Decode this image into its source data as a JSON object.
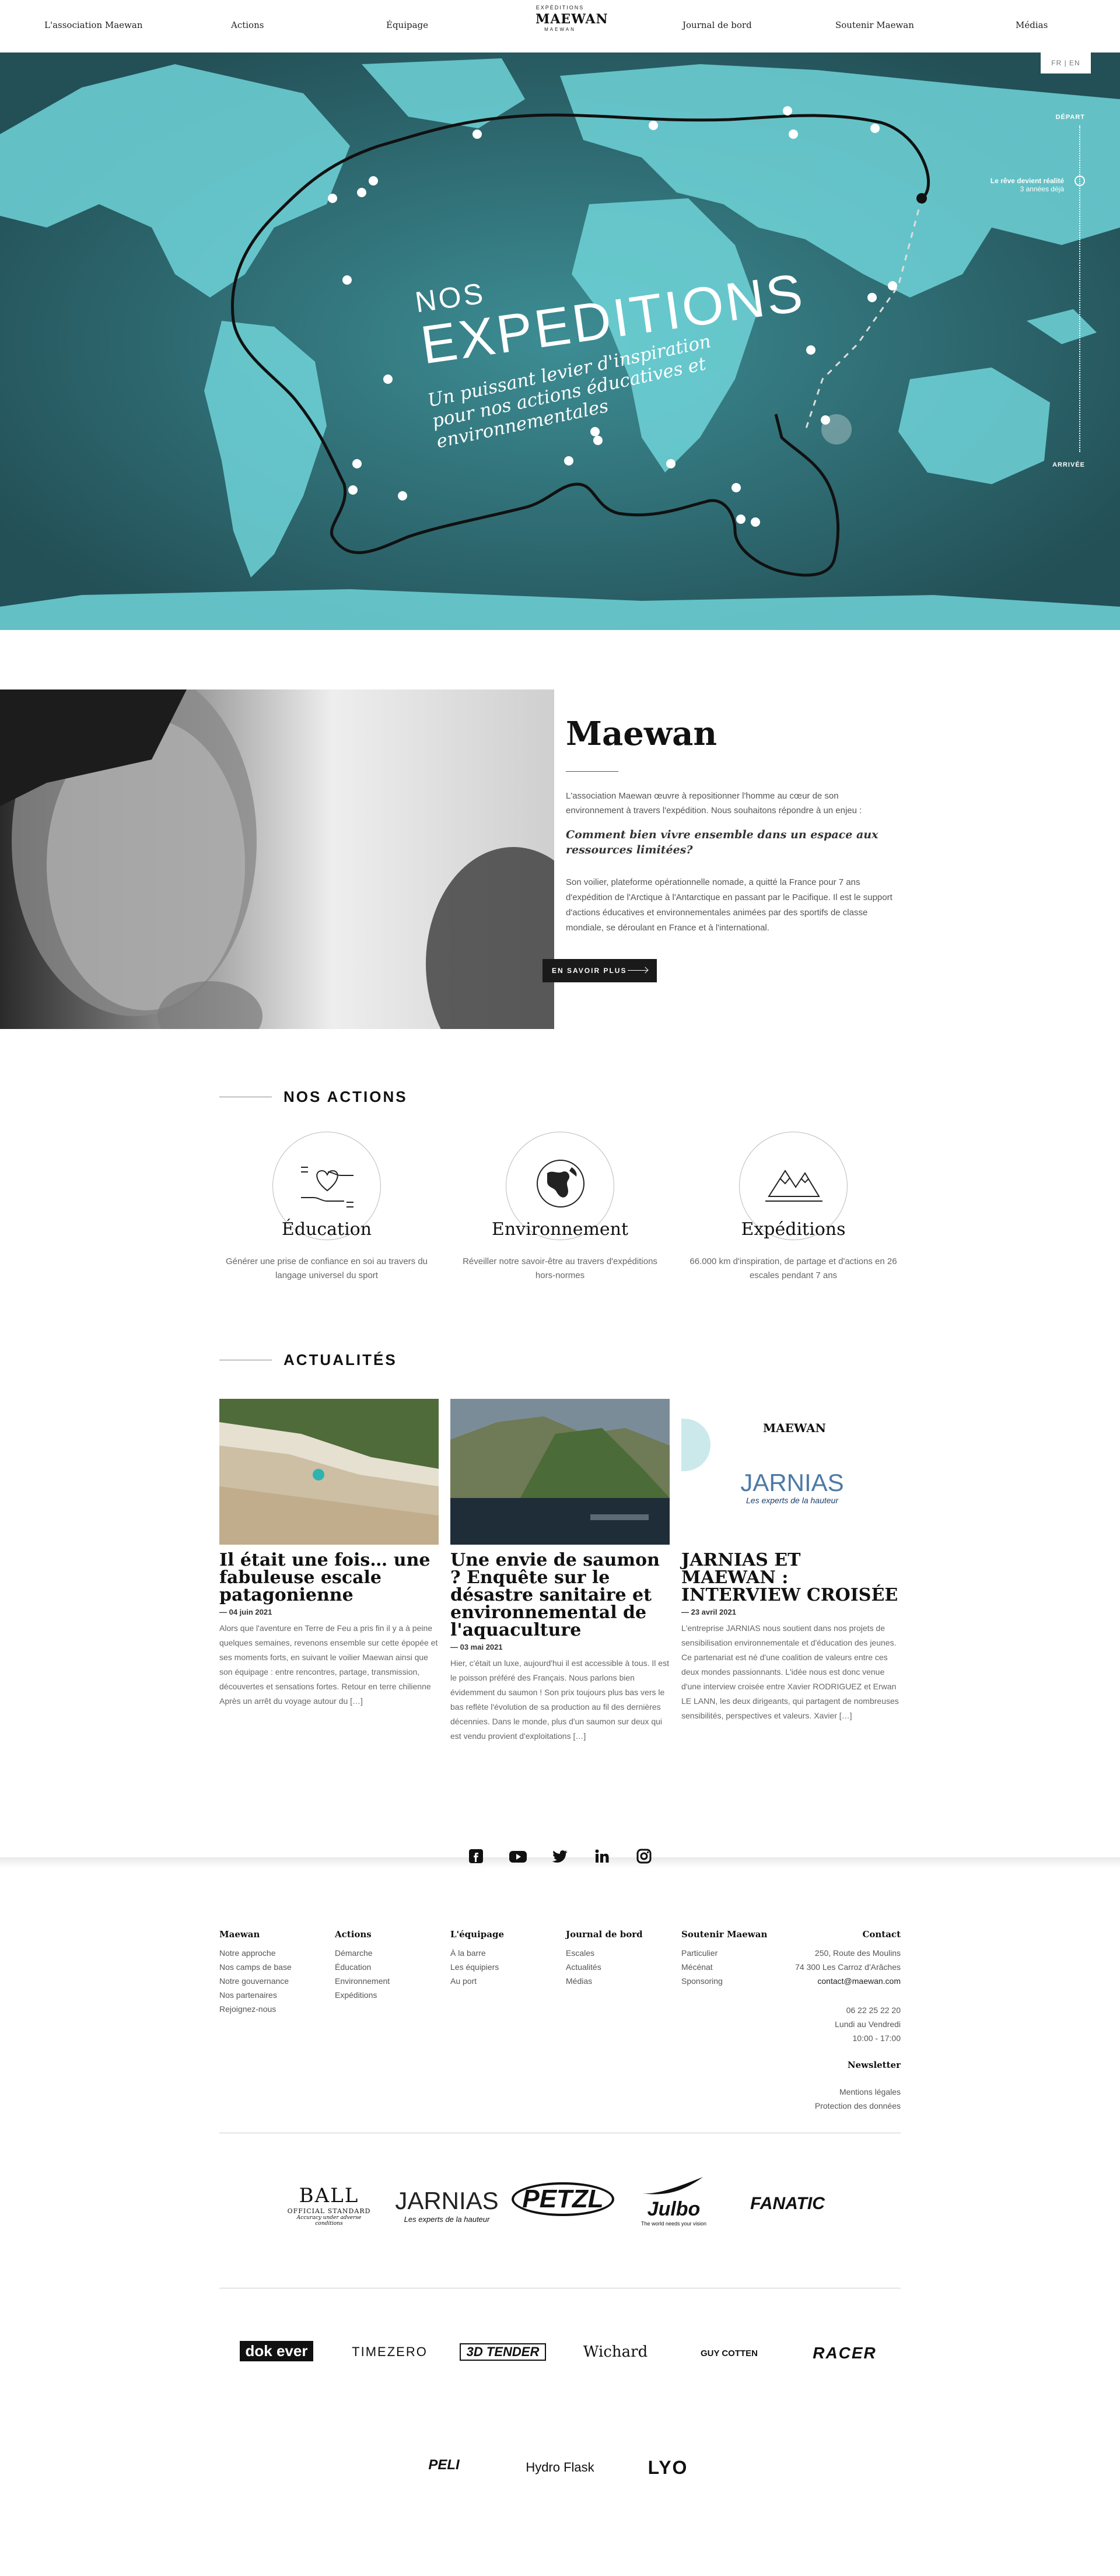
{
  "nav": {
    "items": [
      "L'association Maewan",
      "Actions",
      "Équipage",
      "Journal de bord",
      "Soutenir Maewan",
      "Médias"
    ],
    "logo": {
      "top": "EXPÉDITIONS",
      "word": "MAEWAN",
      "bottom": "MAEWAN"
    }
  },
  "hero": {
    "lang": "FR | EN",
    "title_small": "NOS",
    "title_big": "EXPEDITIONS",
    "subtitle": "Un puissant levier d'inspiration pour nos actions éducatives et environnementales",
    "progress": {
      "start": "DÉPART",
      "end": "ARRIVÉE",
      "callout_title": "Le rêve devient réalité",
      "callout_sub": "3 années déjà"
    }
  },
  "about": {
    "title": "Maewan",
    "p1": "L'association Maewan œuvre à repositionner l'homme au cœur de son environnement à travers l'expédition. Nous souhaitons répondre à un enjeu :",
    "question": "Comment bien vivre ensemble dans un espace aux ressources limitées?",
    "p2": "Son voilier, plateforme opérationnelle nomade, a quitté la France pour 7 ans d'expédition de l'Arctique à l'Antarctique en passant par le Pacifique. Il est le support d'actions éducatives et environnementales animées par des sportifs de classe mondiale, se déroulant en France et à l'international.",
    "button": "EN SAVOIR PLUS"
  },
  "actions": {
    "heading": "NOS ACTIONS",
    "items": [
      {
        "name": "Éducation",
        "desc": "Générer une prise de confiance en soi au travers du langage universel du sport",
        "icon": "hands-heart-icon"
      },
      {
        "name": "Environnement",
        "desc": "Réveiller notre savoir-être au travers d'expéditions hors-normes",
        "icon": "globe-icon"
      },
      {
        "name": "Expéditions",
        "desc": "66.000 km d'inspiration, de partage et d'actions en 26 escales pendant 7 ans",
        "icon": "mountains-icon"
      }
    ]
  },
  "news": {
    "heading": "ACTUALITÉS",
    "items": [
      {
        "title": "Il était une fois… une fabuleuse escale patagonienne",
        "date": "— 04 juin 2021",
        "excerpt": "Alors que l'aventure en Terre de Feu a pris fin il y a à peine quelques semaines, revenons ensemble sur cette épopée et ses moments forts, en suivant le voilier Maewan ainsi que son équipage : entre rencontres, partage, transmission, découvertes et sensations fortes. Retour en terre chilienne Après un arrêt du voyage autour du […]"
      },
      {
        "title": "Une envie de saumon ? Enquête sur le désastre sanitaire et environnemental de l'aquaculture",
        "date": "— 03 mai 2021",
        "excerpt": "Hier, c'était un luxe, aujourd'hui il est accessible à tous. Il est le poisson préféré des Français. Nous parlons bien évidemment du saumon ! Son prix toujours plus bas vers le bas reflète l'évolution de sa production au fil des dernières décennies. Dans le monde, plus d'un saumon sur deux qui est vendu provient d'exploitations […]"
      },
      {
        "title": "JARNIAS ET MAEWAN : INTERVIEW CROISÉE",
        "date": "— 23 avril 2021",
        "excerpt": "L'entreprise JARNIAS nous soutient dans nos projets de sensibilisation environnementale et d'éducation des jeunes. Ce partenariat est né d'une coalition de valeurs entre ces deux mondes passionnants. L'idée nous est donc venue d'une interview croisée entre Xavier RODRIGUEZ et Erwan LE LANN, les deux dirigeants, qui partagent de nombreuses sensibilités, perspectives et valeurs. Xavier […]",
        "logo_word": "MAEWAN",
        "brand": "JARNIAS",
        "brand_tag": "Les experts de la hauteur"
      }
    ]
  },
  "social": [
    "facebook-icon",
    "youtube-icon",
    "twitter-icon",
    "linkedin-icon",
    "instagram-icon"
  ],
  "footer": {
    "cols": [
      {
        "h": "Maewan",
        "links": [
          "Notre approche",
          "Nos camps de base",
          "Notre gouvernance",
          "Nos partenaires",
          "Rejoignez-nous"
        ]
      },
      {
        "h": "Actions",
        "links": [
          "Démarche",
          "Éducation",
          "Environnement",
          "Expéditions"
        ]
      },
      {
        "h": "L'équipage",
        "links": [
          "À la barre",
          "Les équipiers",
          "Au port"
        ]
      },
      {
        "h": "Journal de bord",
        "links": [
          "Escales",
          "Actualités",
          "Médias"
        ]
      },
      {
        "h": "Soutenir Maewan",
        "links": [
          "Particulier",
          "Mécénat",
          "Sponsoring"
        ]
      }
    ],
    "contact": {
      "h": "Contact",
      "address1": "250, Route des Moulins",
      "address2": "74 300 Les Carroz d'Arâches",
      "email": "contact@maewan.com",
      "phone": "06 22 25 22 20",
      "hours1": "Lundi au Vendredi",
      "hours2": "10:00 - 17:00"
    },
    "newsletter": "Newsletter",
    "legal": [
      "Mentions légales",
      "Protection des données"
    ]
  },
  "partners": {
    "row1": [
      "BALL",
      "JARNIAS",
      "PETZL",
      "Julbo",
      "FANATIC"
    ],
    "row1_sub": {
      "ball": "OFFICIAL STANDARD",
      "ball_tag": "Accuracy under adverse conditions",
      "jarnias": "Les experts de la hauteur",
      "julbo": "The world needs your vision"
    },
    "row2": [
      "dok ever",
      "TIMEZERO",
      "3D TENDER",
      "Wichard",
      "GUY COTTEN",
      "RACER"
    ],
    "row3": [
      "PELI",
      "Hydro Flask",
      "LYO"
    ]
  }
}
